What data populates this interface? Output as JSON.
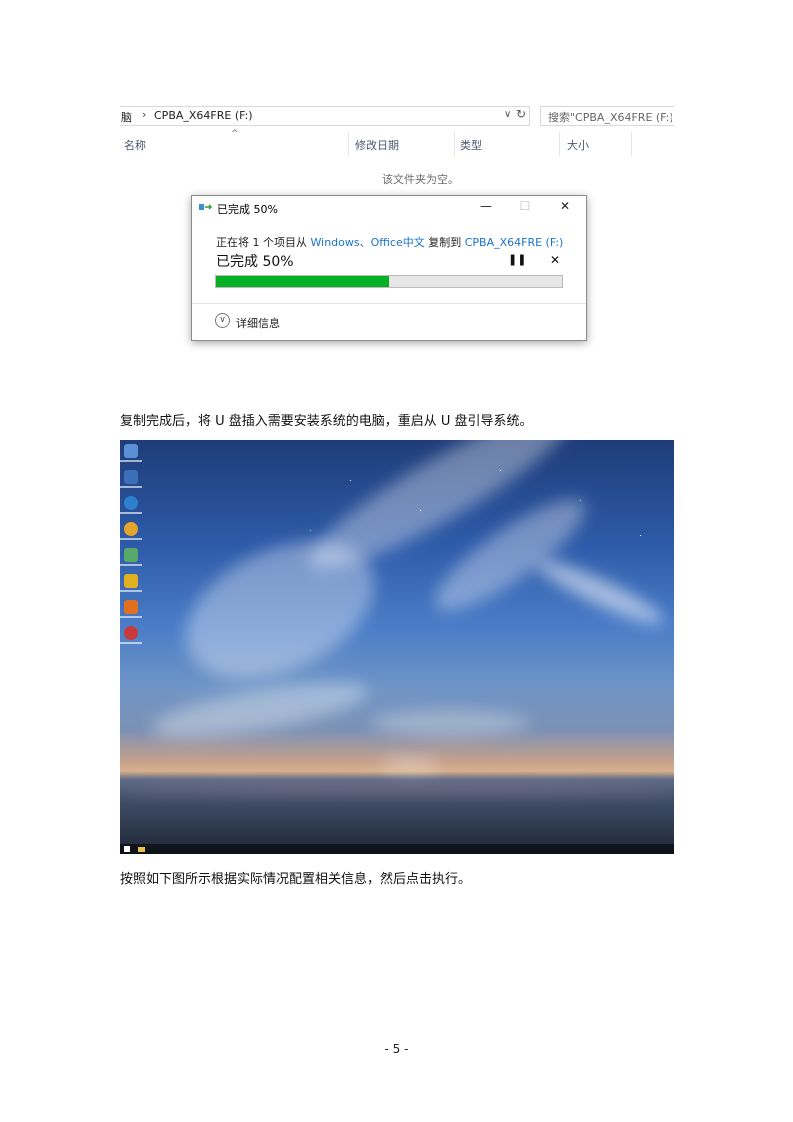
{
  "explorer": {
    "address_prefix": "脑",
    "address_path": "CPBA_X64FRE (F:)",
    "search_placeholder": "搜索\"CPBA_X64FRE (F:)\"",
    "columns": [
      "名称",
      "修改日期",
      "类型",
      "大小"
    ],
    "empty_message": "该文件夹为空。"
  },
  "copy_dialog": {
    "title": "已完成 50%",
    "desc_prefix": "正在将 1 个项目从 ",
    "source": "Windows、Office中文",
    "desc_middle": " 复制到 ",
    "destination": "CPBA_X64FRE (F:)",
    "status": "已完成 50%",
    "progress_percent": 50,
    "details_label": "详细信息",
    "colors": {
      "progress": "#06b025",
      "link": "#1a73c8"
    }
  },
  "document": {
    "para1": "复制完成后，将 U 盘插入需要安装系统的电脑，重启从 U 盘引导系统。",
    "para2": "按照如下图所示根据实际情况配置相关信息，然后点击执行。",
    "page_number": "- 5 -"
  }
}
